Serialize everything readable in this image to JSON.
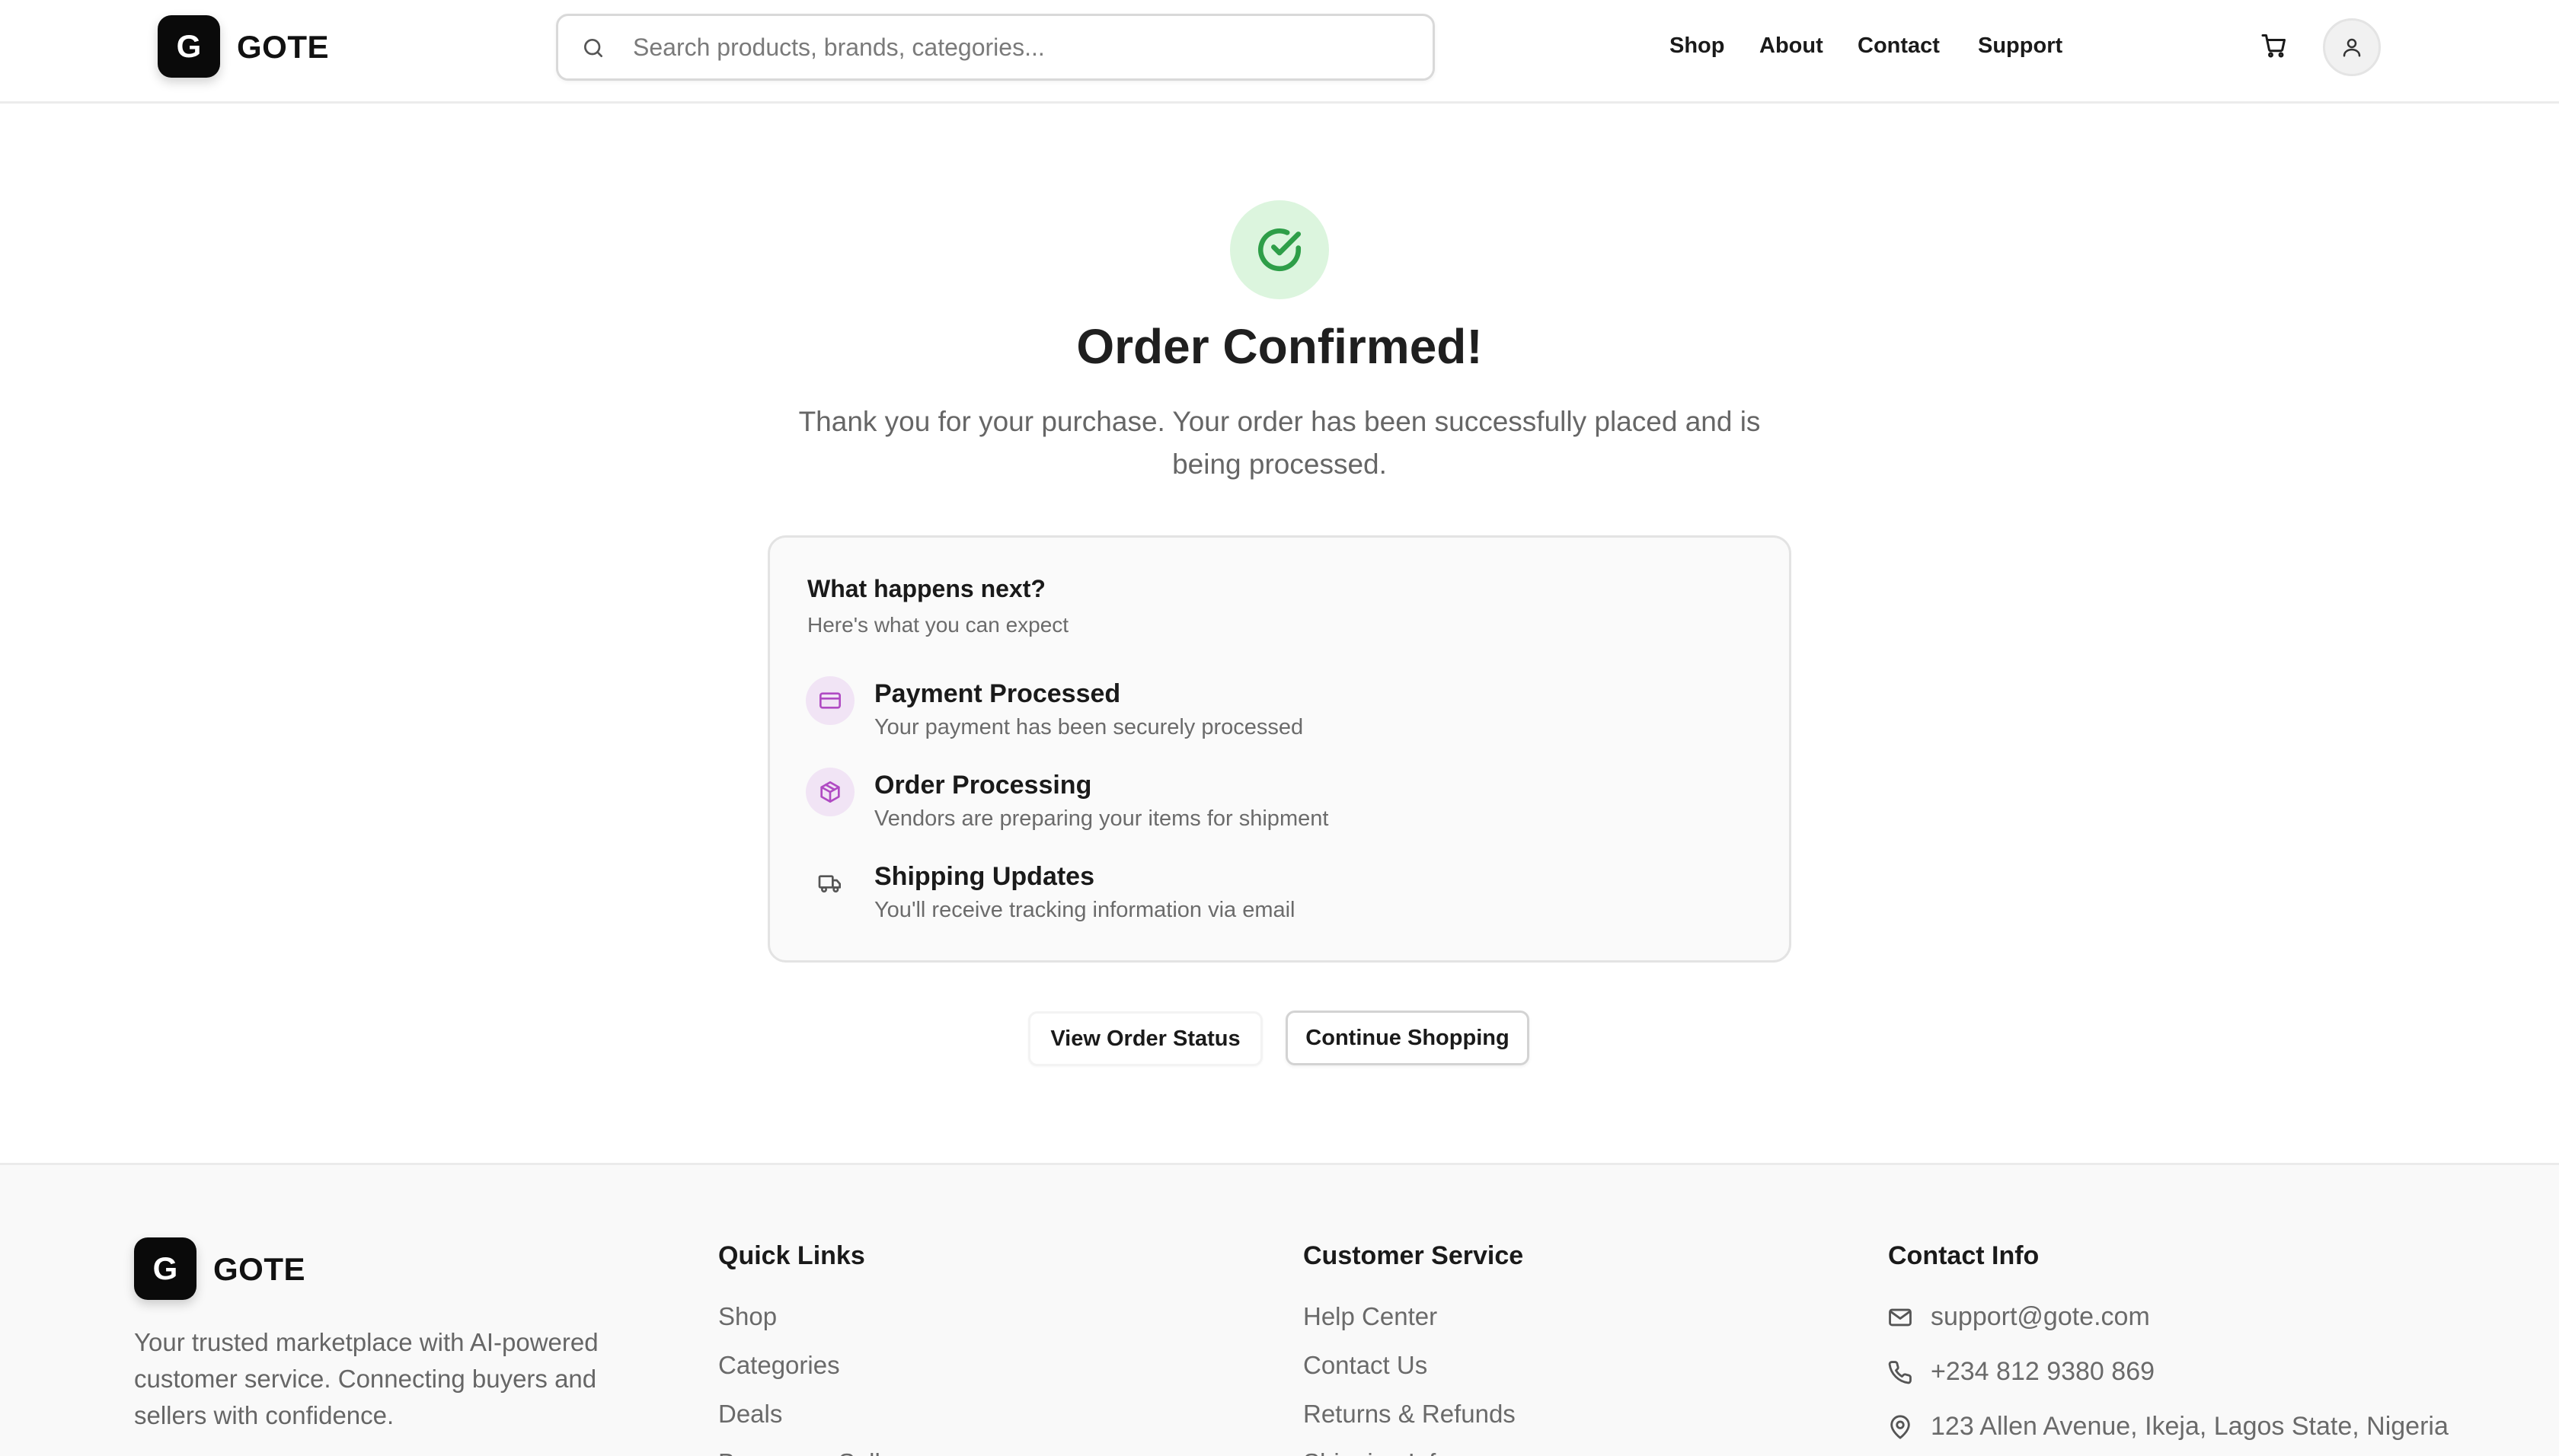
{
  "brand": {
    "logo_letter": "G",
    "name": "GOTE"
  },
  "search": {
    "placeholder": "Search products, brands, categories..."
  },
  "nav": {
    "shop": "Shop",
    "about": "About",
    "contact": "Contact",
    "support": "Support"
  },
  "icons": {
    "search": "search-icon",
    "cart": "cart-icon",
    "user": "user-icon",
    "success": "check-circle-icon",
    "payment": "credit-card-icon",
    "processing": "package-icon",
    "shipping": "truck-icon",
    "email": "mail-icon",
    "phone": "phone-icon",
    "location": "map-pin-icon"
  },
  "colors": {
    "success_bg": "#dcf5de",
    "success": "#2e9e48",
    "step_accent": "#b04bc3",
    "step_bg": "#f1e4f5"
  },
  "main": {
    "title": "Order Confirmed!",
    "message": "Thank you for your purchase. Your order has been successfully placed and is being processed."
  },
  "next": {
    "title": "What happens next?",
    "subtitle": "Here's what you can expect",
    "steps": [
      {
        "title": "Payment Processed",
        "desc": "Your payment has been securely processed"
      },
      {
        "title": "Order Processing",
        "desc": "Vendors are preparing your items for shipment"
      },
      {
        "title": "Shipping Updates",
        "desc": "You'll receive tracking information via email"
      }
    ]
  },
  "actions": {
    "view_status": "View Order Status",
    "continue": "Continue Shopping"
  },
  "footer": {
    "brand_name": "GOTE",
    "description": "Your trusted marketplace with AI-powered customer service. Connecting buyers and sellers with confidence.",
    "quick_links": {
      "heading": "Quick Links",
      "items": [
        "Shop",
        "Categories",
        "Deals",
        "Become a Seller"
      ]
    },
    "customer_service": {
      "heading": "Customer Service",
      "items": [
        "Help Center",
        "Contact Us",
        "Returns & Refunds",
        "Shipping Info"
      ]
    },
    "contact": {
      "heading": "Contact Info",
      "email": "support@gote.com",
      "phone": "+234 812 9380 869",
      "address": "123 Allen Avenue, Ikeja, Lagos State, Nigeria"
    }
  }
}
